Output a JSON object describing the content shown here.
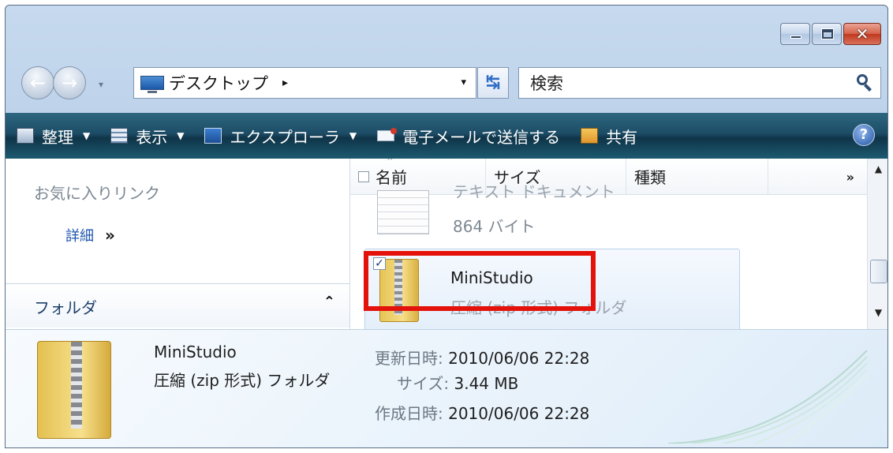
{
  "address_bar": {
    "location": "デスクトップ",
    "separator_glyph": "▸",
    "dropdown_glyph": "▾"
  },
  "search": {
    "placeholder": "検索"
  },
  "toolbar": {
    "organize": "整理",
    "views": "表示",
    "explorer": "エクスプローラ",
    "email": "電子メールで送信する",
    "share": "共有",
    "help": "?"
  },
  "nav_pane": {
    "favorites_title": "お気に入りリンク",
    "details_link": "詳細",
    "details_chevron": "»",
    "folders_title": "フォルダ",
    "folders_caret": "⌃"
  },
  "file_list": {
    "columns": [
      "名前",
      "サイズ",
      "種類"
    ],
    "more_columns": "»",
    "items": [
      {
        "name": "テキスト ドキュメント",
        "size": "864 バイト",
        "icon": "text-document-icon"
      },
      {
        "name": "MiniStudio",
        "type": "圧縮 (zip 形式) フォルダ",
        "icon": "zip-folder-icon",
        "selected": true,
        "checked": true
      }
    ]
  },
  "details_pane": {
    "name": "MiniStudio",
    "type": "圧縮 (zip 形式) フォルダ",
    "modified_label": "更新日時:",
    "modified_value": "2010/06/06 22:28",
    "size_label": "サイズ:",
    "size_value": "3.44 MB",
    "created_label": "作成日時:",
    "created_value": "2010/06/06 22:28"
  },
  "colors": {
    "toolbar_bg": "#1d4d66",
    "highlight_box": "#e3130c",
    "link": "#1f56b0"
  }
}
